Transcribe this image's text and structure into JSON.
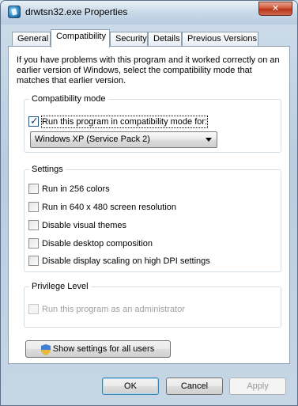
{
  "window": {
    "title": "drwtsn32.exe Properties",
    "close_label": "✕"
  },
  "tabs": [
    {
      "label": "General"
    },
    {
      "label": "Compatibility"
    },
    {
      "label": "Security"
    },
    {
      "label": "Details"
    },
    {
      "label": "Previous Versions"
    }
  ],
  "intro_text": "If you have problems with this program and it worked correctly on an earlier version of Windows, select the compatibility mode that matches that earlier version.",
  "compat_mode": {
    "title": "Compatibility mode",
    "checkbox_label": "Run this program in compatibility mode for:",
    "checked": true,
    "selected_os": "Windows XP (Service Pack 2)"
  },
  "settings": {
    "title": "Settings",
    "items": [
      {
        "label": "Run in 256 colors",
        "checked": false
      },
      {
        "label": "Run in 640 x 480 screen resolution",
        "checked": false
      },
      {
        "label": "Disable visual themes",
        "checked": false
      },
      {
        "label": "Disable desktop composition",
        "checked": false
      },
      {
        "label": "Disable display scaling on high DPI settings",
        "checked": false
      }
    ]
  },
  "privilege": {
    "title": "Privilege Level",
    "admin_label": "Run this program as an administrator",
    "checked": false,
    "disabled": true
  },
  "show_all_users_label": "Show settings for all users",
  "buttons": {
    "ok": "OK",
    "cancel": "Cancel",
    "apply": "Apply"
  },
  "colors": {
    "accent": "#3c7fb1",
    "close": "#c7462b",
    "dialog_bg": "#c6d6e5"
  },
  "icons": {
    "app": "drwtsn32-app-icon",
    "shield": "uac-shield-icon",
    "dropdown": "chevron-down-icon"
  }
}
